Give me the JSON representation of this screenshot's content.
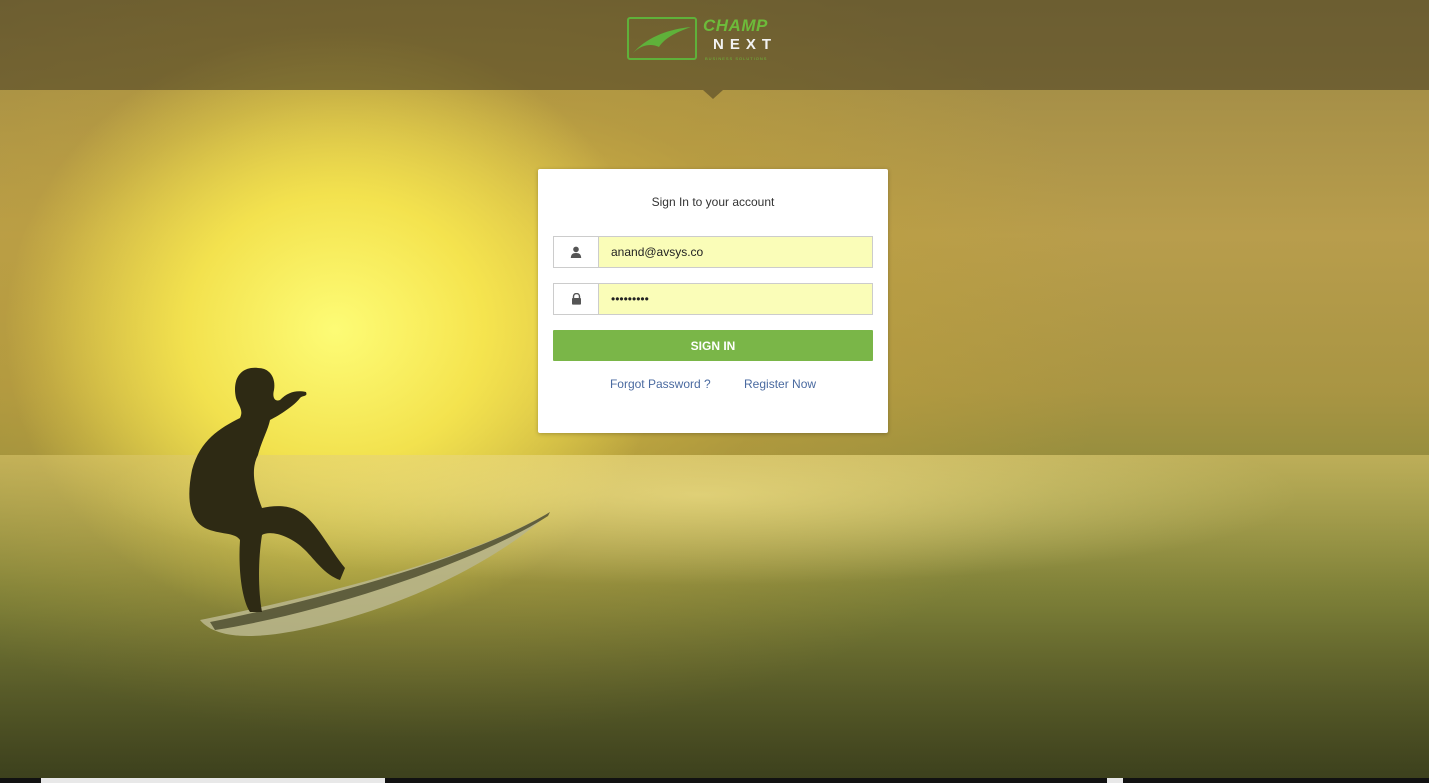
{
  "brand": {
    "line1": "CHAMP",
    "line2": "NEXT",
    "tagline": "BUSINESS SOLUTIONS"
  },
  "login": {
    "title": "Sign In to your account",
    "username_value": "anand@avsys.co",
    "password_value": "•••••••••",
    "submit_label": "SIGN IN",
    "forgot_label": "Forgot Password ?",
    "register_label": "Register Now"
  },
  "icons": {
    "user": "user-icon",
    "lock": "lock-icon"
  },
  "colors": {
    "accent_green": "#7ab648",
    "autofill_yellow": "#fafdb8",
    "link_blue": "#4a6aa0"
  }
}
